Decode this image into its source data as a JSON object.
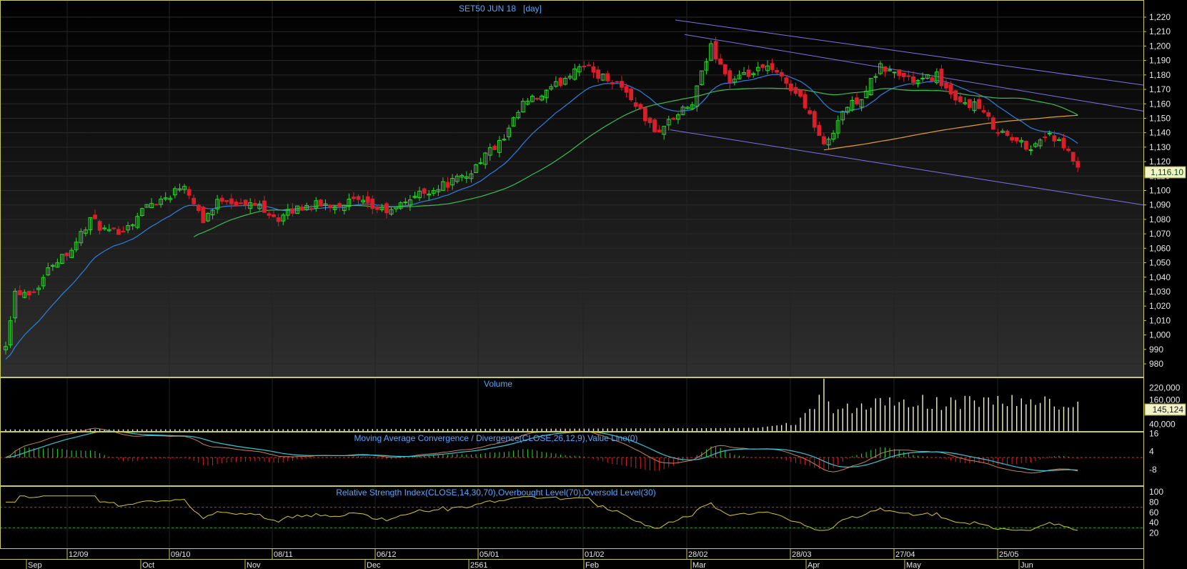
{
  "colors": {
    "frame": "#c9c95a",
    "up": "#2fd62f",
    "down": "#d91f2a",
    "title": "#5aa6ff",
    "tick": "#e6e6e6",
    "last_bg": "#f3f3c8",
    "ma_fast": "#2f7fe0",
    "ma_mid": "#3dbb55",
    "ma_slow": "#e0a030",
    "trend": "#7a74e6",
    "volume": "#f2f2cf",
    "macd": "#c7835a",
    "signal": "#36c8d8",
    "rsi": "#d8c82a"
  },
  "panels": {
    "price_title": "SET50 JUN 18   [day]",
    "volume_title": "Volume",
    "macd_title": "Moving Average Convergence / Divergence(CLOSE,26,12,9),Value Line(0)",
    "rsi_title": "Relative Strength Index(CLOSE,14,30,70),Overbought Level(70),Oversold Level(30)"
  },
  "price_axis_ticks": [
    "1,220",
    "1,210",
    "1,200",
    "1,190",
    "1,180",
    "1,170",
    "1,160",
    "1,150",
    "1,140",
    "1,130",
    "1,120",
    "1,110",
    "1,100",
    "1,090",
    "1,080",
    "1,070",
    "1,060",
    "1,050",
    "1,040",
    "1,030",
    "1,020",
    "1,010",
    "1,000",
    "990",
    "980"
  ],
  "last_price_label": "1,116.10",
  "volume_axis_ticks": [
    "220,000",
    "160,000",
    "40,000"
  ],
  "last_volume_label": "145,124",
  "macd_axis_ticks": [
    "16",
    "4",
    "-8"
  ],
  "rsi_axis_ticks": [
    "100",
    "80",
    "60",
    "40",
    "20"
  ],
  "date_ticks": [
    "12/09",
    "09/10",
    "08/11",
    "06/12",
    "05/01",
    "01/02",
    "28/02",
    "28/03",
    "27/04",
    "25/05"
  ],
  "month_ticks": [
    "Sep",
    "Oct",
    "Nov",
    "Dec",
    "2561",
    "Feb",
    "Mar",
    "Apr",
    "May",
    "Jun"
  ],
  "chart_data": {
    "type": "candlestick",
    "title": "SET50 JUN 18   [day]",
    "period": "day",
    "y_range": [
      975,
      1225
    ],
    "last_close": 1116.1,
    "last_volume": 145124,
    "anchors_close": [
      [
        0,
        995
      ],
      [
        2,
        1030
      ],
      [
        6,
        1030
      ],
      [
        10,
        1050
      ],
      [
        14,
        1060
      ],
      [
        18,
        1080
      ],
      [
        22,
        1070
      ],
      [
        26,
        1075
      ],
      [
        30,
        1090
      ],
      [
        34,
        1095
      ],
      [
        38,
        1105
      ],
      [
        42,
        1080
      ],
      [
        46,
        1095
      ],
      [
        50,
        1090
      ],
      [
        54,
        1090
      ],
      [
        58,
        1080
      ],
      [
        62,
        1088
      ],
      [
        66,
        1090
      ],
      [
        70,
        1090
      ],
      [
        74,
        1093
      ],
      [
        78,
        1088
      ],
      [
        82,
        1085
      ],
      [
        86,
        1095
      ],
      [
        90,
        1100
      ],
      [
        94,
        1105
      ],
      [
        98,
        1110
      ],
      [
        102,
        1125
      ],
      [
        106,
        1135
      ],
      [
        110,
        1160
      ],
      [
        114,
        1165
      ],
      [
        118,
        1175
      ],
      [
        122,
        1188
      ],
      [
        126,
        1180
      ],
      [
        130,
        1175
      ],
      [
        134,
        1160
      ],
      [
        138,
        1140
      ],
      [
        142,
        1150
      ],
      [
        146,
        1160
      ],
      [
        150,
        1200
      ],
      [
        154,
        1175
      ],
      [
        158,
        1180
      ],
      [
        162,
        1185
      ],
      [
        166,
        1175
      ],
      [
        170,
        1160
      ],
      [
        174,
        1130
      ],
      [
        178,
        1155
      ],
      [
        182,
        1165
      ],
      [
        186,
        1185
      ],
      [
        190,
        1180
      ],
      [
        194,
        1175
      ],
      [
        198,
        1180
      ],
      [
        202,
        1160
      ],
      [
        206,
        1160
      ],
      [
        210,
        1145
      ],
      [
        214,
        1135
      ],
      [
        218,
        1130
      ],
      [
        222,
        1140
      ],
      [
        226,
        1125
      ],
      [
        228,
        1116.1
      ]
    ],
    "volume_anchors": [
      [
        0,
        8000
      ],
      [
        60,
        9000
      ],
      [
        120,
        12000
      ],
      [
        148,
        14000
      ],
      [
        160,
        16000
      ],
      [
        168,
        40000
      ],
      [
        172,
        120000
      ],
      [
        174,
        230000
      ],
      [
        176,
        110000
      ],
      [
        180,
        120000
      ],
      [
        190,
        155000
      ],
      [
        200,
        145000
      ],
      [
        210,
        160000
      ],
      [
        220,
        150000
      ],
      [
        228,
        145124
      ]
    ],
    "indicators": {
      "moving_averages": [
        "fast",
        "mid",
        "slow"
      ],
      "macd_params": "CLOSE,26,12,9",
      "rsi_params": "CLOSE,14,30,70",
      "overbought": 70,
      "oversold": 30
    },
    "x_axis_range": [
      "Sep",
      "Jun"
    ],
    "grid": true
  }
}
